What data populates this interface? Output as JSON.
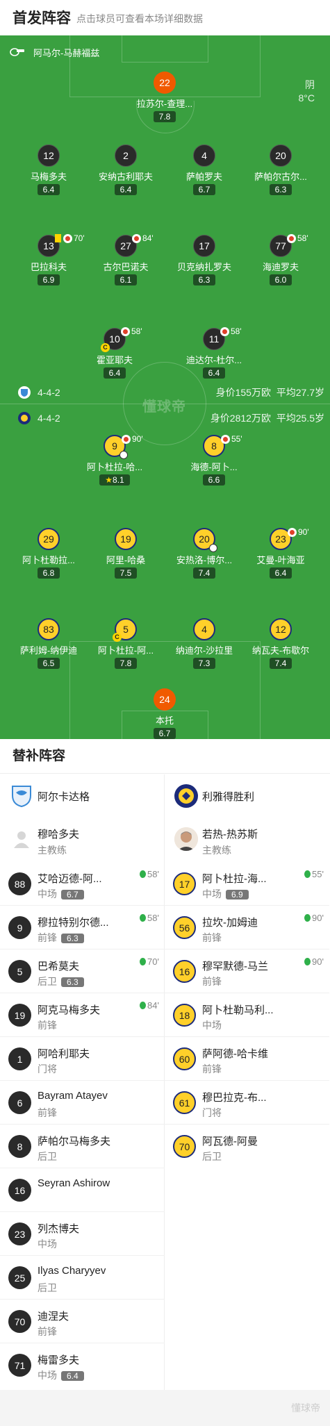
{
  "header": {
    "title": "首发阵容",
    "subtitle": "点击球员可查看本场详细数据"
  },
  "watermark": "懂球帝",
  "weather": {
    "condition": "阴",
    "temperature": "8°C"
  },
  "referee": "阿马尔-马赫福兹",
  "home_team": {
    "name": "阿尔卡达格",
    "formation": "4-4-2",
    "value": "身价155万欧",
    "avg_age": "平均27.7岁"
  },
  "away_team": {
    "name": "利雅得胜利",
    "formation": "4-4-2",
    "value": "身价2812万欧",
    "avg_age": "平均25.5岁"
  },
  "home_players": [
    {
      "number": "22",
      "name": "拉苏尔-查理...",
      "rating": "7.8"
    },
    {
      "number": "12",
      "name": "马梅多夫",
      "rating": "6.4"
    },
    {
      "number": "2",
      "name": "安纳古利耶夫",
      "rating": "6.4"
    },
    {
      "number": "4",
      "name": "萨帕罗夫",
      "rating": "6.7"
    },
    {
      "number": "20",
      "name": "萨帕尔古尔...",
      "rating": "6.3"
    },
    {
      "number": "13",
      "name": "巴拉科夫",
      "rating": "6.9",
      "event": "70'"
    },
    {
      "number": "27",
      "name": "古尔巴诺夫",
      "rating": "6.1",
      "event": "84'"
    },
    {
      "number": "17",
      "name": "贝克纳扎罗夫",
      "rating": "6.3"
    },
    {
      "number": "77",
      "name": "海迪罗夫",
      "rating": "6.0",
      "event": "58'"
    },
    {
      "number": "10",
      "name": "霍亚耶夫",
      "rating": "6.4",
      "event": "58'"
    },
    {
      "number": "11",
      "name": "迪达尔-杜尔...",
      "rating": "6.4",
      "event": "58'"
    }
  ],
  "away_players": [
    {
      "number": "9",
      "name": "阿卜杜拉-哈...",
      "rating": "8.1",
      "event": "90'"
    },
    {
      "number": "8",
      "name": "海德-阿卜...",
      "rating": "6.6",
      "event": "55'"
    },
    {
      "number": "29",
      "name": "阿卜杜勒拉...",
      "rating": "6.8"
    },
    {
      "number": "19",
      "name": "阿里-哈桑",
      "rating": "7.5"
    },
    {
      "number": "20",
      "name": "安热洛-博尔...",
      "rating": "7.4"
    },
    {
      "number": "23",
      "name": "艾曼-叶海亚",
      "rating": "6.4",
      "event": "90'"
    },
    {
      "number": "83",
      "name": "萨利姆-纳伊迪",
      "rating": "6.5"
    },
    {
      "number": "5",
      "name": "阿卜杜拉-阿...",
      "rating": "7.8"
    },
    {
      "number": "4",
      "name": "纳迪尔-沙拉里",
      "rating": "7.3"
    },
    {
      "number": "12",
      "name": "纳瓦夫-布歇尔",
      "rating": "7.4"
    },
    {
      "number": "24",
      "name": "本托",
      "rating": "6.7"
    }
  ],
  "subs_section": {
    "title": "替补阵容"
  },
  "coaches": {
    "home": {
      "name": "穆哈多夫",
      "role": "主教练"
    },
    "away": {
      "name": "若热-热苏斯",
      "role": "主教练"
    }
  },
  "home_subs": [
    {
      "number": "88",
      "name": "艾哈迈德-阿...",
      "position": "中场",
      "rating": "6.7",
      "time": "58'"
    },
    {
      "number": "9",
      "name": "穆拉特别尔德...",
      "position": "前锋",
      "rating": "6.3",
      "time": "58'"
    },
    {
      "number": "5",
      "name": "巴希莫夫",
      "position": "后卫",
      "rating": "6.3",
      "time": "70'"
    },
    {
      "number": "19",
      "name": "阿克马梅多夫",
      "position": "前锋",
      "time": "84'"
    },
    {
      "number": "1",
      "name": "阿哈利耶夫",
      "position": "门将"
    },
    {
      "number": "6",
      "name": "Bayram Atayev",
      "position": "前锋"
    },
    {
      "number": "8",
      "name": "萨帕尔马梅多夫",
      "position": "后卫"
    },
    {
      "number": "16",
      "name": "Seyran Ashirow",
      "position": ""
    },
    {
      "number": "23",
      "name": "列杰博夫",
      "position": "中场"
    },
    {
      "number": "25",
      "name": "Ilyas Charyyev",
      "position": "后卫"
    },
    {
      "number": "70",
      "name": "迪涅夫",
      "position": "前锋"
    },
    {
      "number": "71",
      "name": "梅雷多夫",
      "position": "中场",
      "rating": "6.4"
    }
  ],
  "away_subs": [
    {
      "number": "17",
      "name": "阿卜杜拉-海...",
      "position": "中场",
      "rating": "6.9",
      "time": "55'"
    },
    {
      "number": "56",
      "name": "拉坎-加姆迪",
      "position": "前锋",
      "time": "90'"
    },
    {
      "number": "16",
      "name": "穆罕默德-马兰",
      "position": "前锋",
      "time": "90'"
    },
    {
      "number": "18",
      "name": "阿卜杜勒马利...",
      "position": "中场"
    },
    {
      "number": "60",
      "name": "萨阿德-哈卡维",
      "position": "前锋"
    },
    {
      "number": "61",
      "name": "穆巴拉克-布...",
      "position": "门将"
    },
    {
      "number": "70",
      "name": "阿瓦德-阿曼",
      "position": "后卫"
    }
  ],
  "colors": {
    "pitch": "#3aa040",
    "home_kit": "#2a2a2a",
    "away_kit": "#ffd02a",
    "goalkeeper_home": "#f05a00"
  }
}
